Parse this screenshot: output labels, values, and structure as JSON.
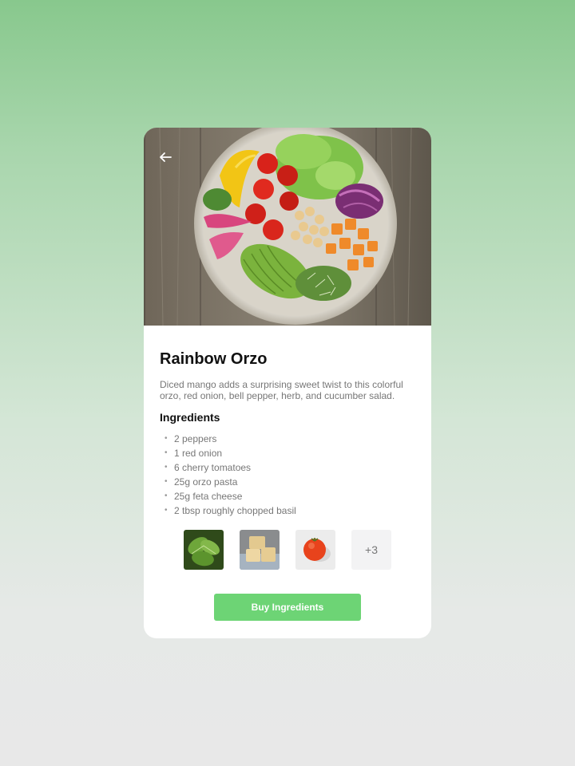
{
  "recipe": {
    "title": "Rainbow Orzo",
    "description": "Diced mango adds a surprising sweet twist to this colorful orzo, red onion, bell pepper, herb, and cucumber salad.",
    "ingredients_heading": "Ingredients",
    "ingredients": [
      "2 peppers",
      "1 red onion",
      "6 cherry tomatoes",
      "25g orzo pasta",
      "25g feta cheese",
      "2 tbsp roughly chopped basil"
    ],
    "bullet": "•"
  },
  "thumbnails": [
    {
      "icon": "basil-photo"
    },
    {
      "icon": "feta-cheese-photo"
    },
    {
      "icon": "tomato-photo"
    }
  ],
  "more_count_label": "+3",
  "buy_button_label": "Buy Ingredients",
  "icons": {
    "back": "back-arrow-icon"
  },
  "colors": {
    "accent": "#6dd475",
    "title": "#111111",
    "body_text": "#777777",
    "card": "#ffffff"
  }
}
